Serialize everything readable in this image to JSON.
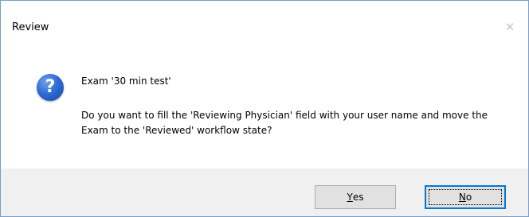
{
  "dialog": {
    "title": "Review",
    "close_glyph": "✕",
    "icon": "question-icon",
    "message_header": "Exam '30 min test'",
    "message_body": "Do you want to fill the 'Reviewing Physician' field with your user name and move the Exam to the 'Reviewed' workflow state?",
    "yes_mnemonic": "Y",
    "yes_rest": "es",
    "no_mnemonic": "N",
    "no_rest": "o"
  },
  "colors": {
    "accent": "#0078d7",
    "window_border": "#7a9cc9",
    "footer_bg": "#f0f0f0"
  }
}
